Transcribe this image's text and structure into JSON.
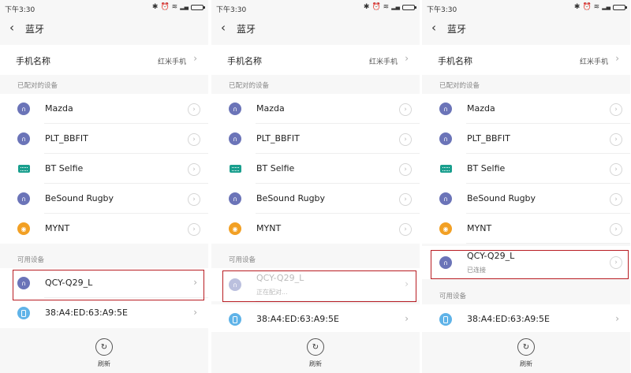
{
  "status": {
    "time": "下午3:30",
    "icons": [
      "bluetooth-icon",
      "alarm-icon",
      "wifi-icon",
      "signal-icon",
      "battery-icon"
    ]
  },
  "header": {
    "back_glyph": "‹",
    "title": "蓝牙"
  },
  "device_name": {
    "label": "手机名称",
    "value": "红米手机"
  },
  "sections": {
    "paired": "已配对的设备",
    "available": "可用设备"
  },
  "paired_devices": [
    {
      "name": "Mazda",
      "icon": "headset-icon"
    },
    {
      "name": "PLT_BBFIT",
      "icon": "headset-icon"
    },
    {
      "name": "BT Selfie",
      "icon": "keyboard-icon"
    },
    {
      "name": "BeSound Rugby",
      "icon": "headset-icon"
    },
    {
      "name": "MYNT",
      "icon": "watch-icon"
    }
  ],
  "target_device": {
    "name": "QCY-Q29_L",
    "pairing_status": "正在配对...",
    "connected_status": "已连接"
  },
  "other_device": {
    "name": "38:A4:ED:63:A9:5E",
    "icon": "phone-icon"
  },
  "bottom": {
    "refresh_label": "刷新"
  },
  "colors": {
    "headset": "#6b74b8",
    "keyboard": "#1a9f8e",
    "watch": "#f2a024",
    "phone": "#5fb3e8",
    "highlight": "#b81c22"
  }
}
